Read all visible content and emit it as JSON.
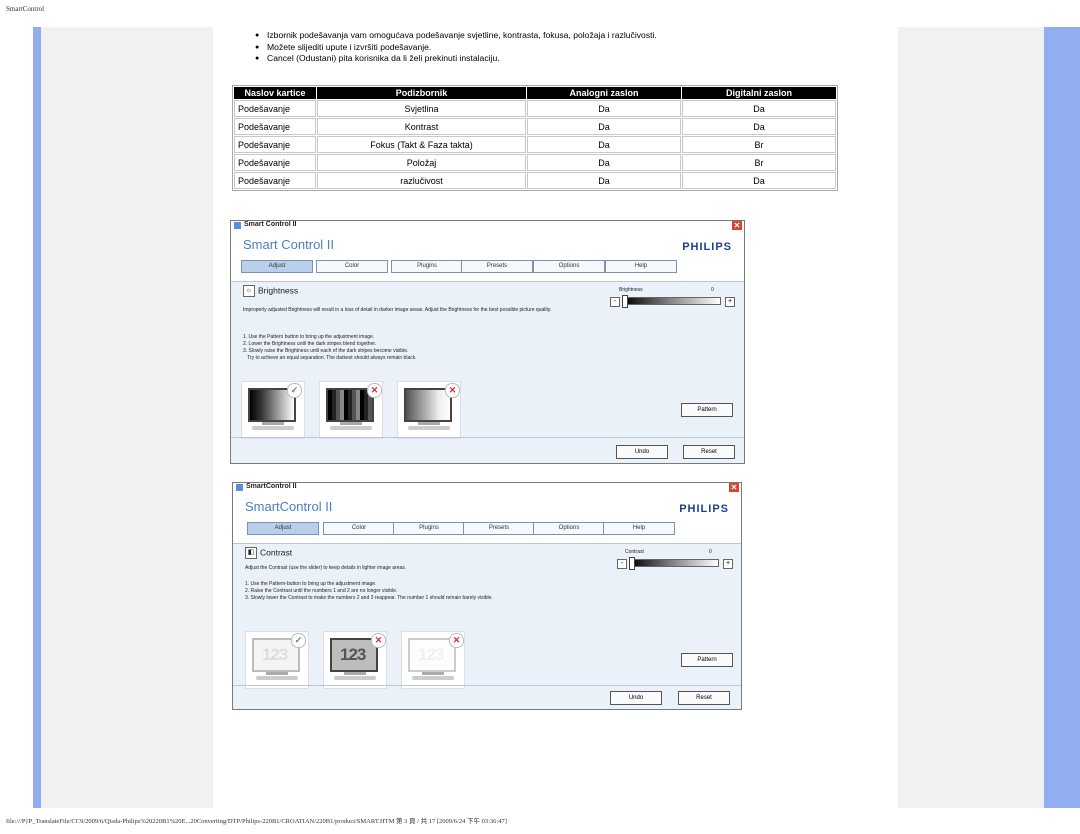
{
  "page": {
    "header": "SmartControl",
    "footer": "file:///P|/P_TranslateFile/CC9/2009/6/Qisda-Philips%20220B1%20E...20Converting/DTP/Philips-220B1/CROATIAN/220B1/product/SMART.HTM 第 3 頁 / 共 17 [2009/6/24 下午 03:36:47]"
  },
  "bullets": [
    "Izbornik podešavanja vam omogućava podešavanje svjetline, kontrasta, fokusa, položaja i razlučivosti.",
    "Možete slijediti upute i izvršiti podešavanje.",
    "Cancel (Odustani) pita korisnika da li želi prekinuti instalaciju."
  ],
  "table": {
    "headers": [
      "Naslov kartice",
      "Podizbornik",
      "Analogni zaslon",
      "Digitalni zaslon"
    ],
    "rows": [
      [
        "Podešavanje",
        "Svjetlina",
        "Da",
        "Da"
      ],
      [
        "Podešavanje",
        "Kontrast",
        "Da",
        "Da"
      ],
      [
        "Podešavanje",
        "Fokus (Takt & Faza takta)",
        "Da",
        "Br"
      ],
      [
        "Podešavanje",
        "Položaj",
        "Da",
        "Br"
      ],
      [
        "Podešavanje",
        "razlučivost",
        "Da",
        "Da"
      ]
    ]
  },
  "windows": {
    "brightness": {
      "titlebar": "Smart Control II",
      "app_title": "Smart Control II",
      "logo": "PHILIPS",
      "tabs": [
        "Adjust",
        "Color",
        "Plugins",
        "Presets",
        "Options",
        "Help"
      ],
      "section": "Brightness",
      "desc1": "Improperly adjusted Brightness will result in a loss of detail in darker image areas. Adjust the Brightness for the best possible picture quality.",
      "desc2": "1. Use the Pattern button to bring up the adjustment image.\n2. Lower the Brightness until the dark stripes blend together.\n3. Slowly raise the Brightness until each of the dark stripes become visible.\n   Try to achieve an equal separation. The darkest should always remain black.",
      "slider_label": "Brightness",
      "slider_value": "0",
      "pattern": "Pattern",
      "undo": "Undo",
      "reset": "Reset"
    },
    "contrast": {
      "titlebar": "SmartControl II",
      "app_title": "SmartControl II",
      "logo": "PHILIPS",
      "tabs": [
        "Adjust",
        "Color",
        "Plugins",
        "Presets",
        "Options",
        "Help"
      ],
      "section": "Contrast",
      "desc1": "Adjust the Contrast (use the slider) to keep details in lighter image areas.",
      "desc2": "1. Use the Pattern-button to bring up the adjustment image.\n2. Raise the Contrast until the numbers 1 and 2 are no longer visible.\n3. Slowly lower the Contrast to make the numbers 2 and 3 reappear. The number 1 should remain barely visible.",
      "slider_label": "Contrast",
      "slider_value": "0",
      "digits": "123",
      "pattern": "Pattern",
      "undo": "Undo",
      "reset": "Reset"
    }
  },
  "icons": {
    "check": "check-icon",
    "cross": "cross-icon",
    "close": "close-icon",
    "brightness": "sun-icon",
    "contrast": "contrast-icon"
  },
  "colors": {
    "side_blue": "#93aef0",
    "side_gray": "#f1f1f1",
    "app_title": "#4a7fc0",
    "logo": "#1a3f98"
  }
}
